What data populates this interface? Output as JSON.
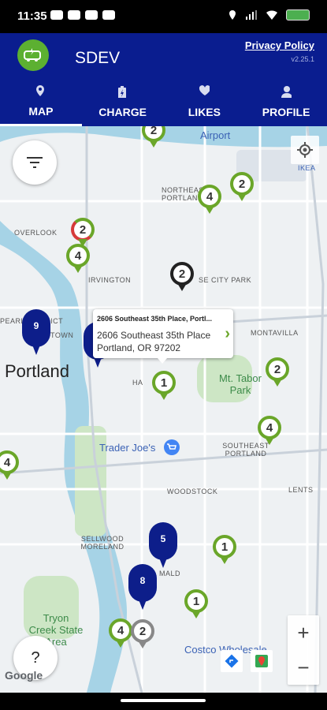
{
  "status_bar": {
    "time": "11:35"
  },
  "header": {
    "app_title": "SDEV",
    "privacy_link": "Privacy Policy",
    "version": "v2.25.1",
    "tabs": [
      {
        "label": "MAP",
        "icon": "map-pin-icon",
        "active": true
      },
      {
        "label": "CHARGE",
        "icon": "battery-icon",
        "active": false
      },
      {
        "label": "LIKES",
        "icon": "heart-icon",
        "active": false
      },
      {
        "label": "PROFILE",
        "icon": "person-icon",
        "active": false
      }
    ]
  },
  "map": {
    "labels": {
      "airport": "Airport",
      "ikea": "IKEA",
      "northeast_portland": "NORTHEAST PORTLAND",
      "overlook": "OVERLOOK",
      "irvington": "IRVINGTON",
      "rose_city_park": "SE CITY PARK",
      "pearl": "PEARL DISTRICT",
      "old_town": "TOWN",
      "montavilla": "MONTAVILLA",
      "portland": "Portland",
      "hawthorne": "HA",
      "mt_tabor": "Mt. Tabor Park",
      "southeast_portland": "SOUTHEAST PORTLAND",
      "trader_joes": "Trader Joe's",
      "woodstock": "WOODSTOCK",
      "lents": "LENTS",
      "sellwood": "SELLWOOD MORELAND",
      "waverly": "MALD",
      "tryon": "Tryon Creek State Area",
      "costco": "Costco Wholesale",
      "google": "Google"
    },
    "pins": [
      {
        "count": "2",
        "style": "green"
      },
      {
        "count": "2",
        "style": "green"
      },
      {
        "count": "4",
        "style": "green"
      },
      {
        "count": "2",
        "style": "red"
      },
      {
        "count": "4",
        "style": "green"
      },
      {
        "count": "2",
        "style": "black"
      },
      {
        "count": "1",
        "style": "green"
      },
      {
        "count": "2",
        "style": "green"
      },
      {
        "count": "4",
        "style": "green"
      },
      {
        "count": "4",
        "style": "green"
      },
      {
        "count": "1",
        "style": "green"
      },
      {
        "count": "1",
        "style": "green"
      },
      {
        "count": "4",
        "style": "green"
      },
      {
        "count": "2",
        "style": "gray"
      }
    ],
    "cluster_pins": [
      {
        "count": "9"
      },
      {
        "count": "5"
      },
      {
        "count": "8"
      }
    ],
    "popup": {
      "title": "2606 Southeast 35th Place, Portl...",
      "line1": "2606 Southeast 35th Place",
      "line2": "Portland, OR 97202"
    },
    "controls": {
      "zoom_in": "+",
      "zoom_out": "−",
      "help": "?"
    }
  },
  "colors": {
    "header": "#0a1d8f",
    "pin_green": "#6aa629",
    "cluster_navy": "#0d1e8a"
  }
}
